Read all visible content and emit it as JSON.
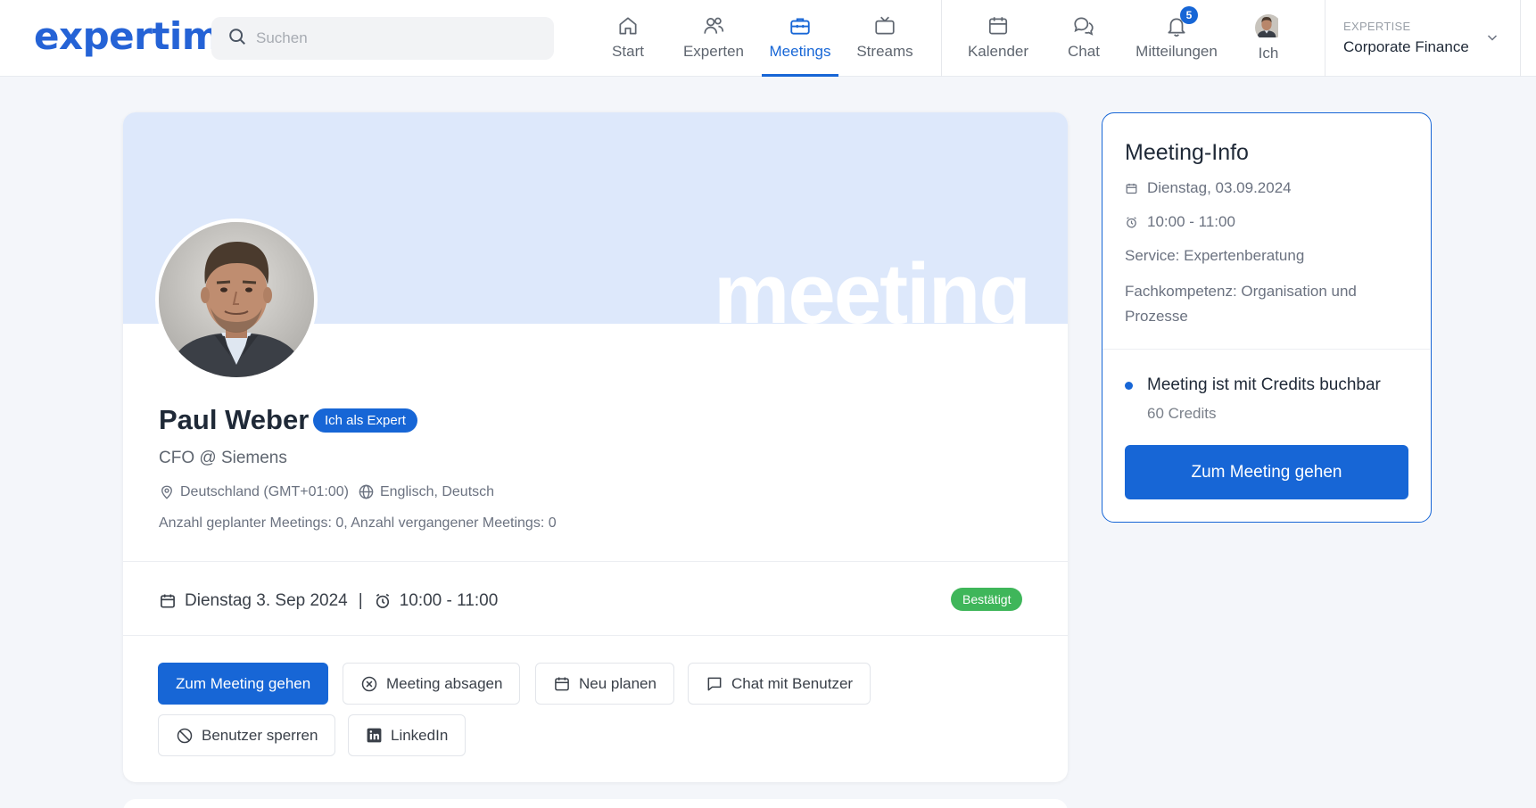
{
  "header": {
    "logo": "expertim.",
    "search_placeholder": "Suchen",
    "nav": {
      "start": "Start",
      "experten": "Experten",
      "meetings": "Meetings",
      "streams": "Streams",
      "kalender": "Kalender",
      "chat": "Chat",
      "mitteilungen": "Mitteilungen",
      "ich": "Ich"
    },
    "notification_count": "5",
    "expertise_label": "EXPERTISE",
    "expertise_value": "Corporate Finance",
    "accent_color": "#1766d6"
  },
  "profile": {
    "banner_word": "meeting",
    "name": "Paul Weber",
    "role_badge": "Ich als Expert",
    "position": "CFO @ Siemens",
    "location": "Deutschland (GMT+01:00)",
    "languages": "Englisch, Deutsch",
    "counts": "Anzahl geplanter Meetings: 0,  Anzahl vergangener Meetings: 0"
  },
  "meeting": {
    "date": "Dienstag 3. Sep 2024",
    "time": "10:00 - 11:00",
    "status": "Bestätigt",
    "status_color": "#3fb65a"
  },
  "actions": {
    "join": "Zum Meeting gehen",
    "cancel": "Meeting absagen",
    "reschedule": "Neu planen",
    "chat": "Chat mit Benutzer",
    "block": "Benutzer sperren",
    "linkedin": "LinkedIn"
  },
  "info": {
    "title": "Meeting-Info",
    "date": "Dienstag, 03.09.2024",
    "time": "10:00 - 11:00",
    "service": "Service: Expertenberatung",
    "competence": "Fachkompetenz: Organisation und Prozesse",
    "credits_label": "Meeting ist mit Credits buchbar",
    "credits_amount": "60 Credits",
    "button": "Zum Meeting gehen"
  }
}
